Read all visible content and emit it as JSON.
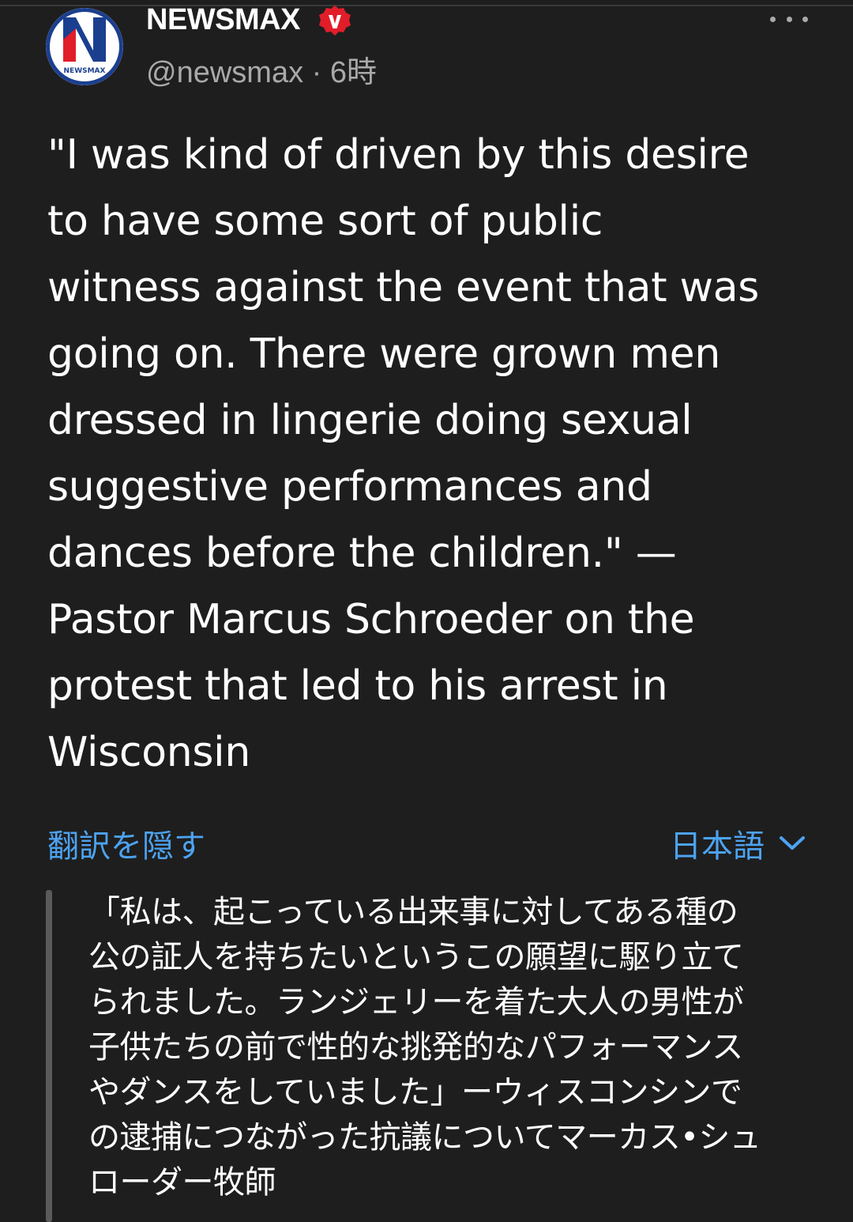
{
  "tweet": {
    "account_name": "NEWSMAX",
    "avatar_text": "NEWSMAX",
    "handle_time": "@newsmax · 6時",
    "text": "\"I was kind of driven by this desire\nto have some sort of public\nwitness against the event that was\ngoing on. There were grown men\ndressed in lingerie doing sexual\nsuggestive performances and\ndances before the children.\" —\nPastor Marcus Schroeder on the\nprotest that led to his arrest in\nWisconsin"
  },
  "translation": {
    "hide_label": "翻訳を隠す",
    "language_label": "日本語",
    "text": "「私は、起こっている出来事に対してある種の\n公の証人を持ちたいというこの願望に駆り立て\nられました。ランジェリーを着た大人の男性が\n子供たちの前で性的な挑発的なパフォーマンス\nやダンスをしていました」ーウィスコンシンで\nの逮捕につながった抗議についてマーカス•シュ\nローダー牧師"
  },
  "icons": {
    "avatar": "newsmax-logo-icon",
    "verified": "verified-badge-icon",
    "more": "more-options-icon",
    "language_dropdown": "chevron-down-icon"
  },
  "colors": {
    "background": "#1e1e1e",
    "link": "#4da3f2",
    "secondary_text": "#a9a9a9",
    "badge_red": "#e11d2a",
    "logo_blue": "#1b3f8f"
  }
}
